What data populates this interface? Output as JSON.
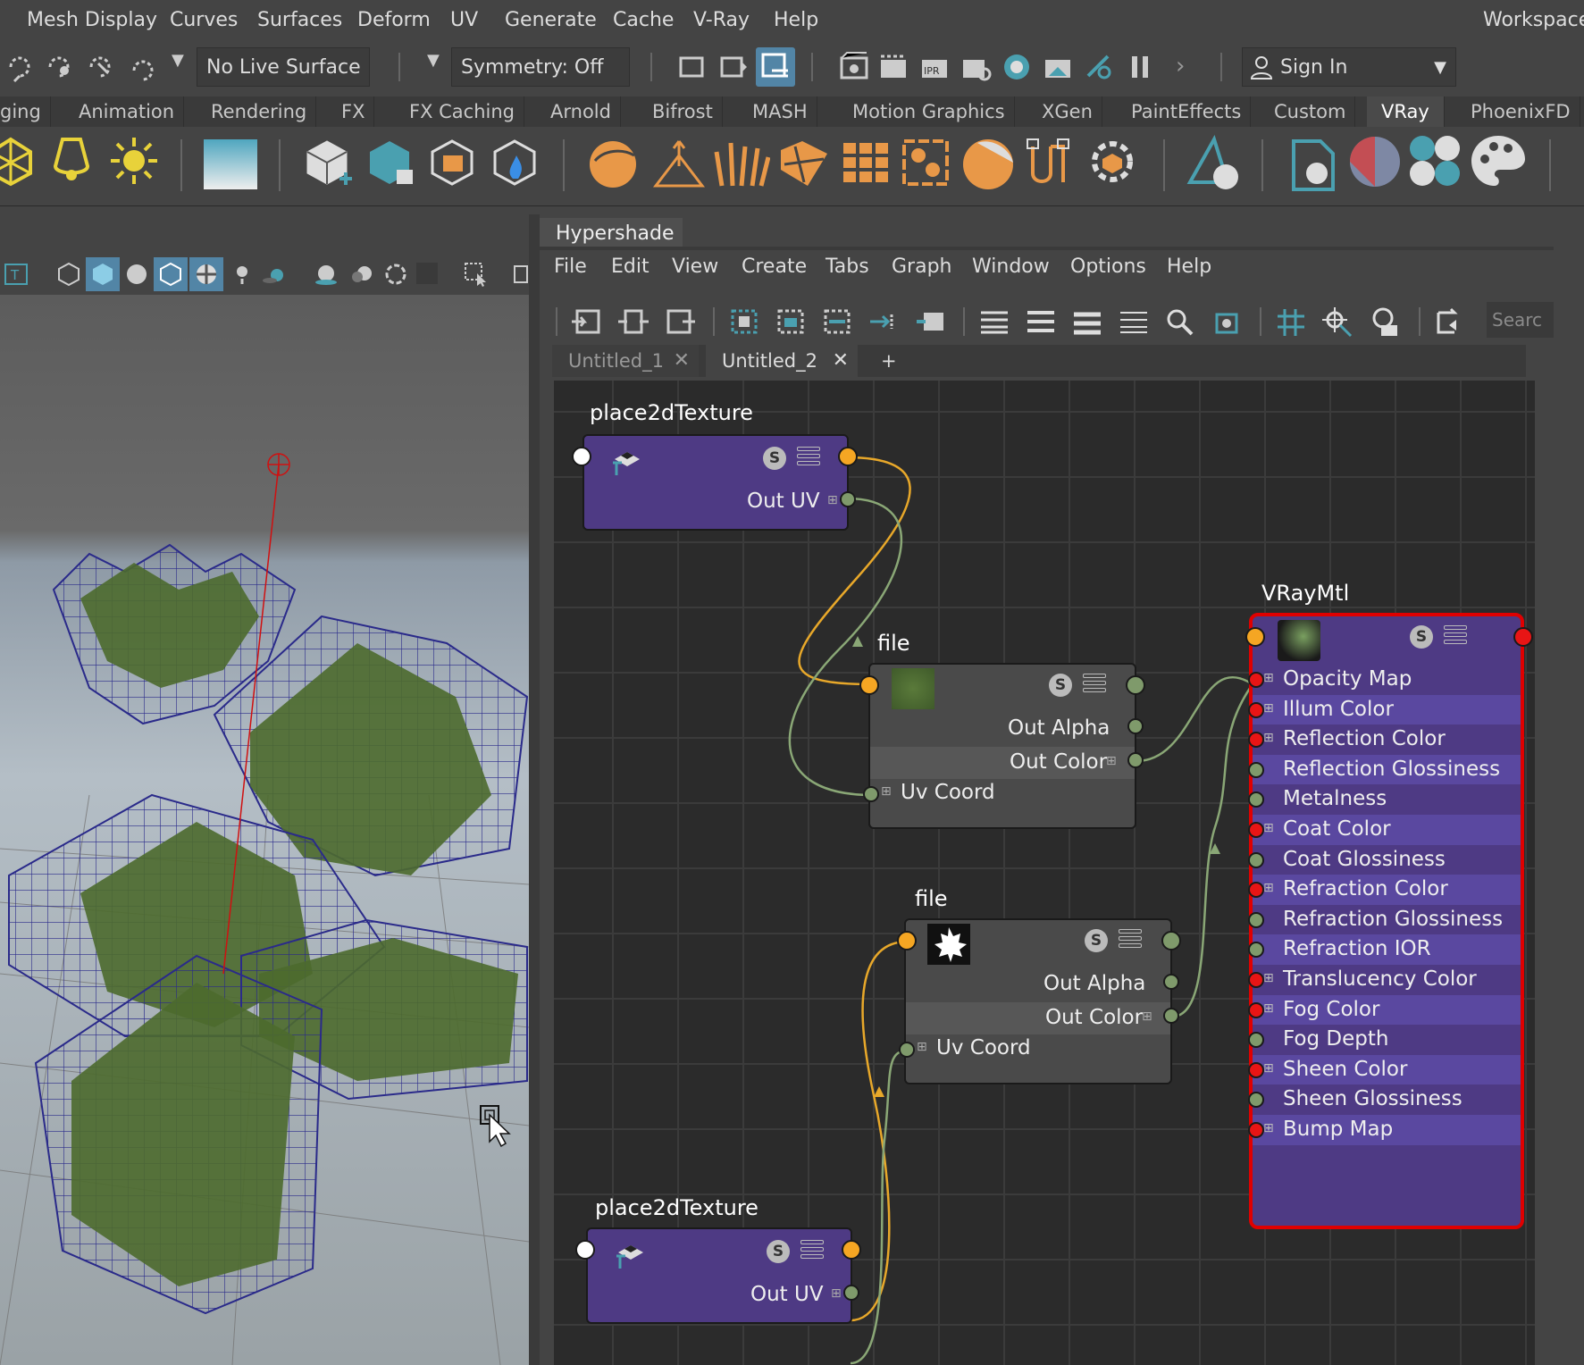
{
  "menubar": {
    "items": [
      "Mesh Display",
      "Curves",
      "Surfaces",
      "Deform",
      "UV",
      "Generate",
      "Cache",
      "V-Ray",
      "Help"
    ],
    "workspace_label": "Workspace:"
  },
  "statusline": {
    "live_surface": "No Live Surface",
    "symmetry": "Symmetry: Off",
    "sign_in": "Sign In"
  },
  "shelf_tabs": [
    {
      "label": "ging",
      "active": false
    },
    {
      "label": "Animation",
      "active": false
    },
    {
      "label": "Rendering",
      "active": false
    },
    {
      "label": "FX",
      "active": false
    },
    {
      "label": "FX Caching",
      "active": false
    },
    {
      "label": "Arnold",
      "active": false
    },
    {
      "label": "Bifrost",
      "active": false
    },
    {
      "label": "MASH",
      "active": false
    },
    {
      "label": "Motion Graphics",
      "active": false
    },
    {
      "label": "XGen",
      "active": false
    },
    {
      "label": "PaintEffects",
      "active": false
    },
    {
      "label": "Custom",
      "active": false
    },
    {
      "label": "VRay",
      "active": true
    },
    {
      "label": "PhoenixFD",
      "active": false
    }
  ],
  "hypershade": {
    "title": "Hypershade",
    "menu": [
      "File",
      "Edit",
      "View",
      "Create",
      "Tabs",
      "Graph",
      "Window",
      "Options",
      "Help"
    ],
    "search_placeholder": "Searc",
    "tabs": [
      {
        "label": "Untitled_1",
        "active": false
      },
      {
        "label": "Untitled_2",
        "active": true
      }
    ],
    "add_tab": "+"
  },
  "graph": {
    "place2d_top": {
      "title": "place2dTexture",
      "out_uv": "Out UV",
      "swatch_letter": "S"
    },
    "file_top": {
      "title": "file",
      "out_alpha": "Out Alpha",
      "out_color": "Out Color",
      "uv_coord": "Uv Coord",
      "swatch_letter": "S"
    },
    "file_bottom": {
      "title": "file",
      "out_alpha": "Out Alpha",
      "out_color": "Out Color",
      "uv_coord": "Uv Coord",
      "swatch_letter": "S"
    },
    "place2d_bottom": {
      "title": "place2dTexture",
      "out_uv": "Out UV",
      "swatch_letter": "S"
    },
    "vraymtl": {
      "title": "VRayMtl",
      "swatch_letter": "S",
      "attributes": [
        {
          "label": "Opacity Map",
          "port": "red",
          "expand": true
        },
        {
          "label": "Illum Color",
          "port": "red",
          "expand": true
        },
        {
          "label": "Reflection Color",
          "port": "red",
          "expand": true
        },
        {
          "label": "Reflection Glossiness",
          "port": "green",
          "expand": false
        },
        {
          "label": "Metalness",
          "port": "green",
          "expand": false
        },
        {
          "label": "Coat Color",
          "port": "red",
          "expand": true
        },
        {
          "label": "Coat Glossiness",
          "port": "green",
          "expand": false
        },
        {
          "label": "Refraction Color",
          "port": "red",
          "expand": true
        },
        {
          "label": "Refraction Glossiness",
          "port": "green",
          "expand": false
        },
        {
          "label": "Refraction IOR",
          "port": "green",
          "expand": false
        },
        {
          "label": "Translucency Color",
          "port": "red",
          "expand": true
        },
        {
          "label": "Fog Color",
          "port": "red",
          "expand": true
        },
        {
          "label": "Fog Depth",
          "port": "green",
          "expand": false
        },
        {
          "label": "Sheen Color",
          "port": "red",
          "expand": true
        },
        {
          "label": "Sheen Glossiness",
          "port": "green",
          "expand": false
        },
        {
          "label": "Bump Map",
          "port": "red",
          "expand": true
        }
      ]
    }
  },
  "colors": {
    "node_purple": "#4e3a84",
    "selected_border": "#e00000",
    "port_orange": "#f5a623",
    "port_green": "#7f9a6b",
    "port_red": "#e81515",
    "wire_orange": "#e8a82a",
    "wire_green": "#8aa776"
  }
}
